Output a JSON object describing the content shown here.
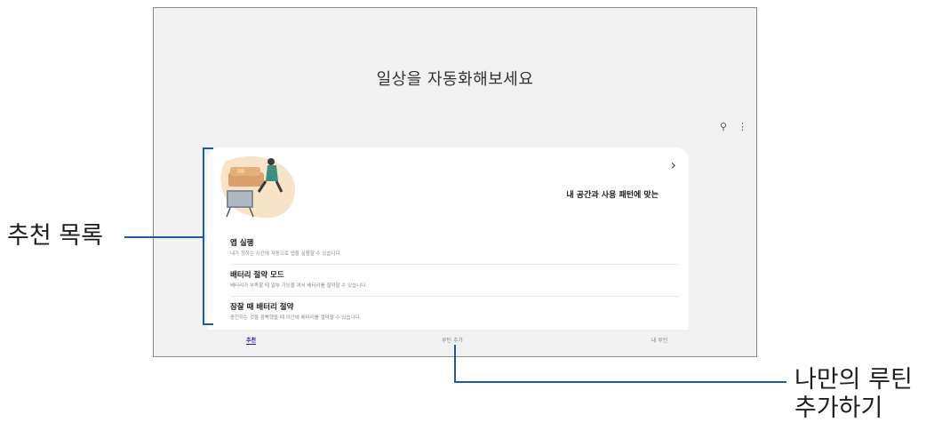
{
  "screen": {
    "title": "일상을 자동화해보세요",
    "actions": [
      {
        "name": "search-icon",
        "glyph": "⚲"
      },
      {
        "name": "more-options-icon",
        "glyph": "⋮"
      }
    ],
    "featured": {
      "chevron": "›",
      "text": "내 공간과 사용 패턴에 맞는"
    },
    "list": [
      {
        "title": "앱 실행",
        "subtitle": "내가 정하는 시간에 자동으로 앱을 실행할 수 있습니다."
      },
      {
        "title": "배터리 절약 모드",
        "subtitle": "배터리가 부족할 때 일부 기능을 꺼서 배터리를 절약할 수 있습니다."
      },
      {
        "title": "잠잘 때 배터리 절약",
        "subtitle": "충전하는 것을 깜빡했을 때 야간에 배터리를 절약할 수 있습니다."
      }
    ],
    "tabs": [
      {
        "label": "추천",
        "active": true
      },
      {
        "label": "루틴 추가",
        "active": false
      },
      {
        "label": "내 루틴",
        "active": false
      }
    ]
  },
  "callouts": {
    "left": "추천 목록",
    "bottom_line1": "나만의 루틴",
    "bottom_line2": "추가하기"
  },
  "colors": {
    "callout_line": "#1f5a9e",
    "active_tab": "#1a1a8c",
    "screen_bg": "#f1f1f1"
  }
}
